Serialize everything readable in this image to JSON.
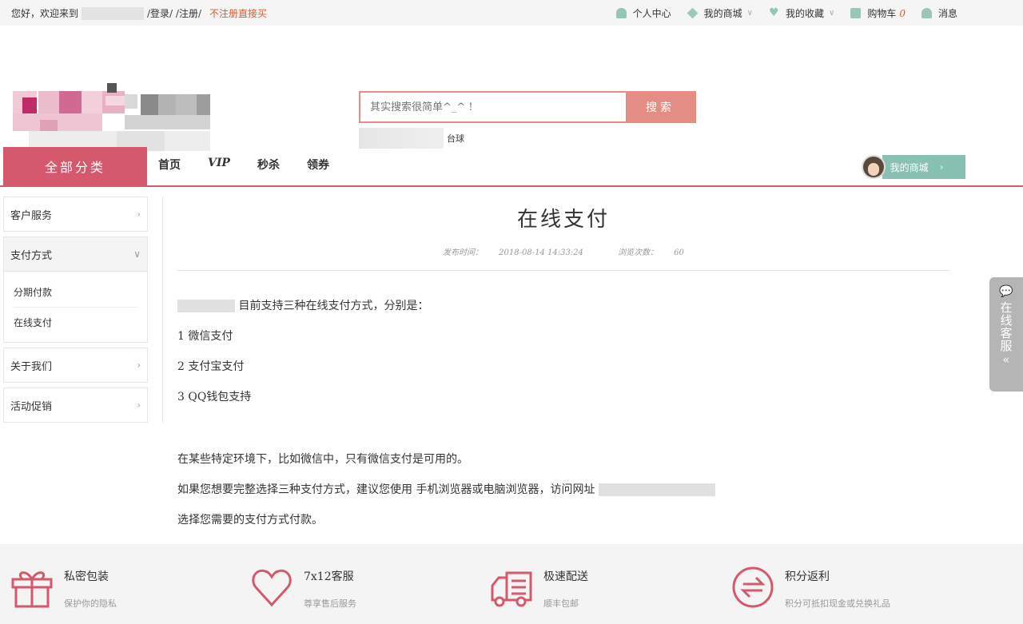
{
  "topbar": {
    "greeting": "您好，欢迎来到",
    "login_register": "/登录/ /注册/",
    "quick_login": "不注册直接买",
    "personal_center": "个人中心",
    "my_mall": "我的商城",
    "my_favorites": "我的收藏",
    "cart": "购物车",
    "cart_count": "0",
    "messages": "消息"
  },
  "search": {
    "placeholder": "其实搜索很简单^_^ !",
    "button": "搜索",
    "hotword": "台球"
  },
  "nav": {
    "all_categories": "全部分类",
    "links": [
      "首页",
      "VIP",
      "秒杀",
      "领券"
    ],
    "my_mall": "我的商城"
  },
  "sidebar": {
    "items": [
      {
        "label": "客户服务"
      },
      {
        "label": "支付方式",
        "sub": [
          "分期付款",
          "在线支付"
        ]
      },
      {
        "label": "关于我们"
      },
      {
        "label": "活动促销"
      }
    ]
  },
  "article": {
    "title": "在线支付",
    "publish_label": "发布时间：",
    "publish_time": "2018-08-14 14:33:24",
    "views_label": "浏览次数：",
    "views": "60",
    "intro": "目前支持三种在线支付方式，分别是：",
    "methods": [
      "1 微信支付",
      "2 支付宝支付",
      "3 QQ钱包支持"
    ],
    "note1": "在某些特定环境下，比如微信中，只有微信支付是可用的。",
    "note2": "如果您想要完整选择三种支付方式，建议您使用 手机浏览器或电脑浏览器，访问网址",
    "note3": "选择您需要的支付方式付款。"
  },
  "online_service": "在线客服",
  "footer": [
    {
      "title": "私密包装",
      "sub": "保护你的隐私",
      "icon": "gift-icon"
    },
    {
      "title": "7x12客服",
      "sub": "尊享售后服务",
      "icon": "heart-icon"
    },
    {
      "title": "极速配送",
      "sub": "顺丰包邮",
      "icon": "truck-icon"
    },
    {
      "title": "积分返利",
      "sub": "积分可抵扣现金或兑换礼品",
      "icon": "exchange-icon"
    }
  ],
  "colors": {
    "accent": "#d5596c",
    "teal": "#88c0b2",
    "search": "#e38d84"
  }
}
